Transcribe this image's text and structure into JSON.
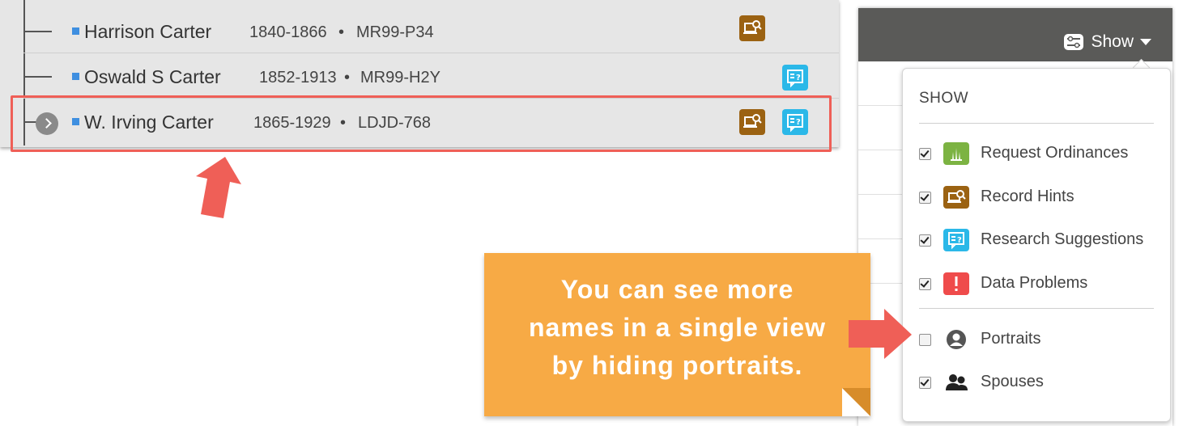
{
  "tree": {
    "rows": [
      {
        "name": "Harrison Carter",
        "dates": "1840-1866",
        "sep": "•",
        "pid": "MR99-P34",
        "hints": [
          "record-hint"
        ]
      },
      {
        "name": "Oswald S Carter",
        "dates": "1852-1913",
        "sep": "•",
        "pid": "MR99-H2Y",
        "hints": [
          "research-suggestion"
        ]
      },
      {
        "name": "W. Irving Carter",
        "dates": "1865-1929",
        "sep": "•",
        "pid": "LDJD-768",
        "hints": [
          "record-hint",
          "research-suggestion"
        ]
      }
    ]
  },
  "header": {
    "show_label": "Show"
  },
  "dropdown": {
    "title": "SHOW",
    "options": [
      {
        "label": "Request Ordinances",
        "checked": true,
        "icon": "temple-icon",
        "color": "#7cb342"
      },
      {
        "label": "Record Hints",
        "checked": true,
        "icon": "record-hint-icon",
        "color": "#9b6212"
      },
      {
        "label": "Research Suggestions",
        "checked": true,
        "icon": "research-suggestion-icon",
        "color": "#2bb8e8"
      },
      {
        "label": "Data Problems",
        "checked": true,
        "icon": "exclamation-icon",
        "color": "#ef4b4b"
      },
      {
        "label": "Portraits",
        "checked": false,
        "icon": "portrait-icon",
        "color": "#555555"
      },
      {
        "label": "Spouses",
        "checked": true,
        "icon": "spouses-icon",
        "color": "#222222"
      }
    ]
  },
  "callout": {
    "lines": [
      "You can see more",
      "names in a single view",
      "by hiding portraits."
    ]
  },
  "colors": {
    "highlight": "#ef5f57",
    "callout_bg": "#f7aa45",
    "header_bg": "#5a5a58"
  }
}
